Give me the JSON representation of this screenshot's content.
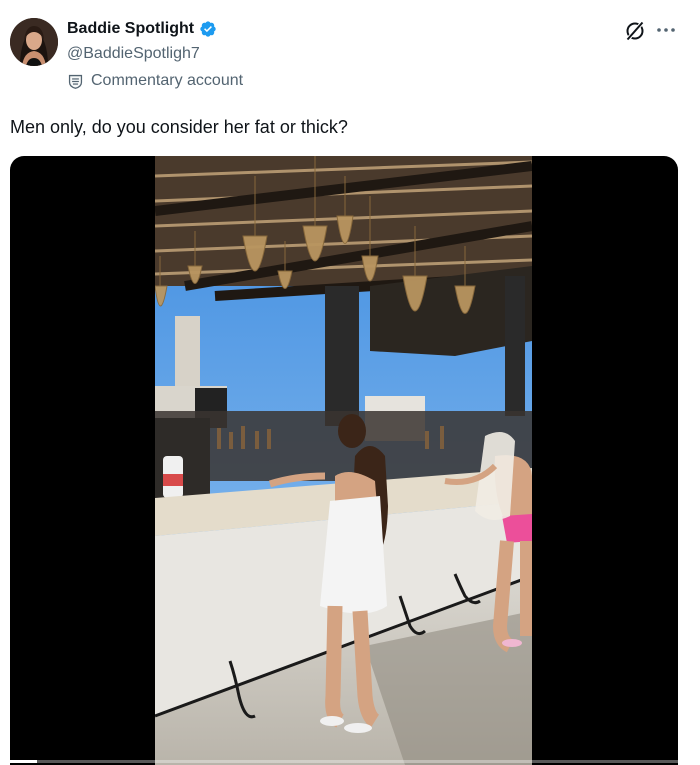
{
  "author": {
    "display_name": "Baddie Spotlight",
    "handle": "@BaddieSpotligh7",
    "verified": true,
    "verified_color": "#1d9bf0",
    "affiliation_label": "Commentary account",
    "affiliation_icon": "label-badge-icon"
  },
  "actions": {
    "grok_icon": "grok-icon",
    "more_icon": "more-horizontal-icon"
  },
  "tweet": {
    "text": "Men only, do you consider her fat or thick?"
  },
  "media": {
    "type": "video",
    "playback_progress": 0.04
  }
}
